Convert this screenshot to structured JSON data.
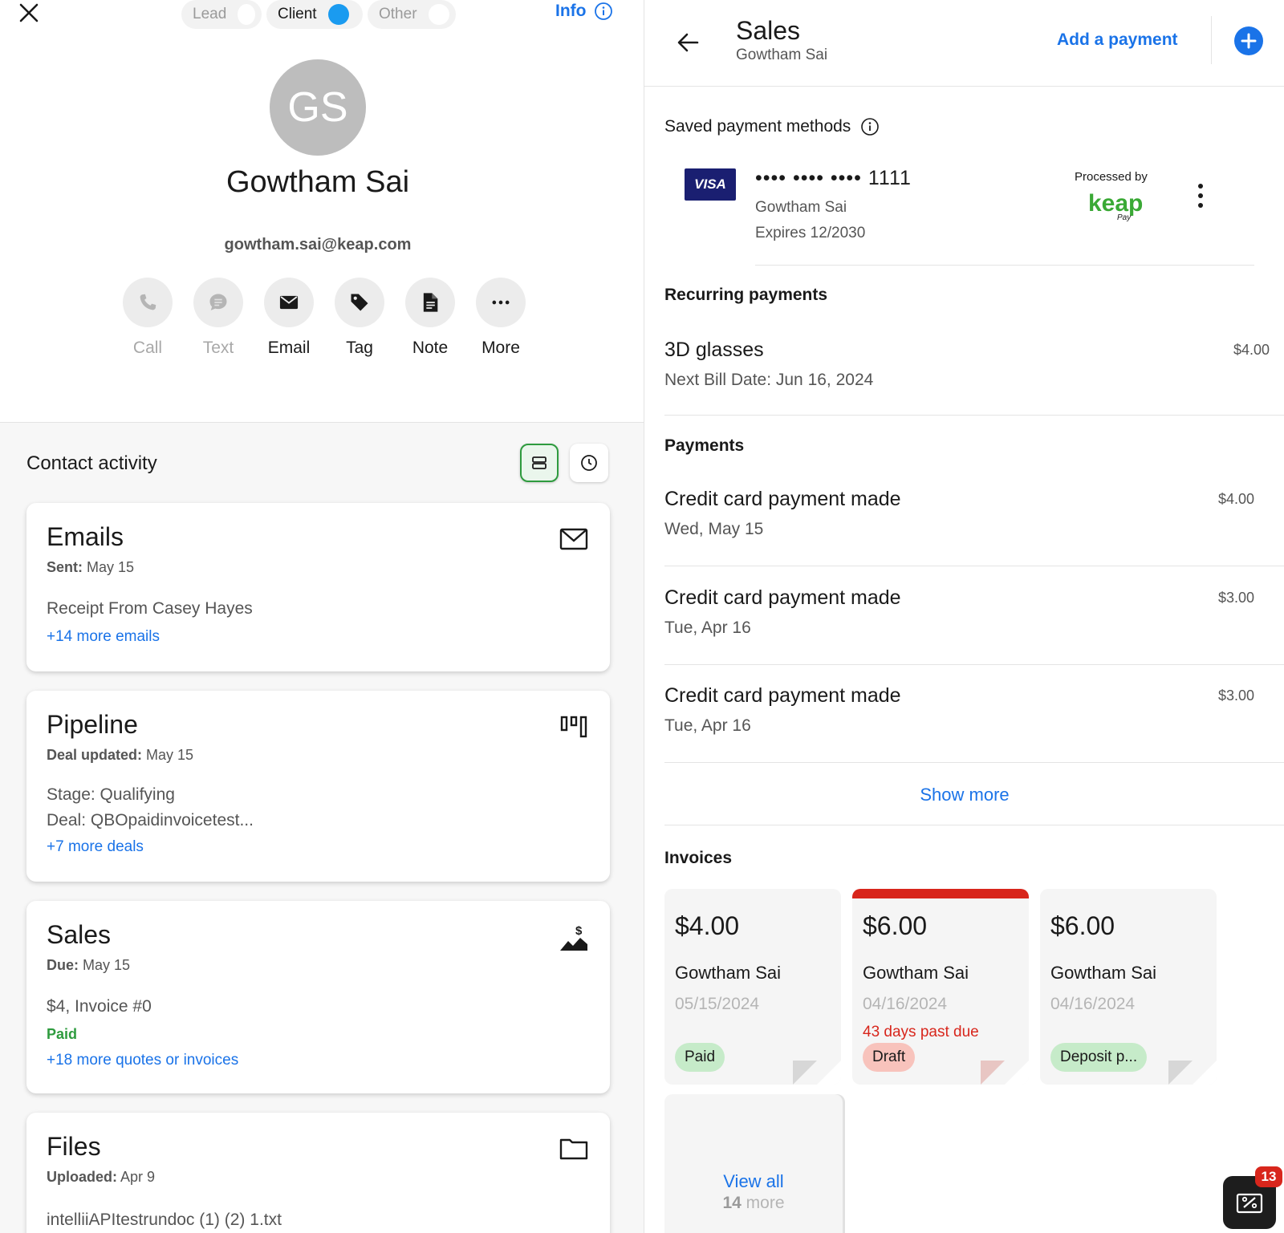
{
  "contact": {
    "initials": "GS",
    "name": "Gowtham Sai",
    "email": "gowtham.sai@keap.com"
  },
  "status_toggle": {
    "options": [
      "Lead",
      "Client",
      "Other"
    ],
    "selected": "Client"
  },
  "info_link": "Info",
  "actions": [
    {
      "label": "Call",
      "icon": "phone-icon",
      "enabled": false
    },
    {
      "label": "Text",
      "icon": "chat-icon",
      "enabled": false
    },
    {
      "label": "Email",
      "icon": "envelope-icon",
      "enabled": true
    },
    {
      "label": "Tag",
      "icon": "tag-icon",
      "enabled": true
    },
    {
      "label": "Note",
      "icon": "note-icon",
      "enabled": true
    },
    {
      "label": "More",
      "icon": "more-icon",
      "enabled": true
    }
  ],
  "activity": {
    "title": "Contact activity",
    "cards": {
      "emails": {
        "title": "Emails",
        "meta_label": "Sent:",
        "meta_value": "May 15",
        "line1": "Receipt From Casey Hayes",
        "link": "+14 more emails"
      },
      "pipeline": {
        "title": "Pipeline",
        "meta_label": "Deal updated:",
        "meta_value": "May 15",
        "line1": "Stage: Qualifying",
        "line2": "Deal: QBOpaidinvoicetest...",
        "link": "+7 more deals"
      },
      "sales": {
        "title": "Sales",
        "meta_label": "Due:",
        "meta_value": "May 15",
        "line1": "$4, Invoice #0",
        "status": "Paid",
        "link": "+18 more quotes or invoices"
      },
      "files": {
        "title": "Files",
        "meta_label": "Uploaded:",
        "meta_value": "Apr 9",
        "line1": "intelliiAPItestrundoc (1) (2) 1.txt"
      }
    }
  },
  "sales_panel": {
    "title": "Sales",
    "subtitle": "Gowtham Sai",
    "add_payment": "Add a payment",
    "saved_methods_label": "Saved payment methods",
    "card": {
      "brand": "VISA",
      "number_masked": "•••• •••• •••• 1111",
      "holder": "Gowtham Sai",
      "expires": "Expires 12/2030",
      "processed_by": "Processed by",
      "processor_logo_text": "keap",
      "processor_logo_sub": "Pay"
    },
    "recurring_label": "Recurring payments",
    "recurring": [
      {
        "name": "3D glasses",
        "next_bill": "Next Bill Date: Jun 16, 2024",
        "amount": "$4.00"
      }
    ],
    "payments_label": "Payments",
    "payments": [
      {
        "title": "Credit card payment made",
        "date": "Wed, May 15",
        "amount": "$4.00"
      },
      {
        "title": "Credit card payment made",
        "date": "Tue, Apr 16",
        "amount": "$3.00"
      },
      {
        "title": "Credit card payment made",
        "date": "Tue, Apr 16",
        "amount": "$3.00"
      }
    ],
    "show_more": "Show more",
    "invoices_label": "Invoices",
    "invoices": [
      {
        "amount": "$4.00",
        "name": "Gowtham Sai",
        "date": "05/15/2024",
        "past_due": "",
        "status": "Paid"
      },
      {
        "amount": "$6.00",
        "name": "Gowtham Sai",
        "date": "04/16/2024",
        "past_due": "43 days past due",
        "status": "Draft"
      },
      {
        "amount": "$6.00",
        "name": "Gowtham Sai",
        "date": "04/16/2024",
        "past_due": "",
        "status": "Deposit p..."
      }
    ],
    "view_all": "View all",
    "view_all_count": "14",
    "view_all_suffix": "more"
  },
  "fab": {
    "badge": "13",
    "icon": "coupon-icon"
  },
  "colors": {
    "accent_blue": "#1a73e8",
    "toggle_blue": "#1a9bf0",
    "paid_green": "#2e9b3e",
    "overdue_red": "#d8261c",
    "visa_navy": "#1a1f71",
    "keap_green": "#3aa935"
  }
}
